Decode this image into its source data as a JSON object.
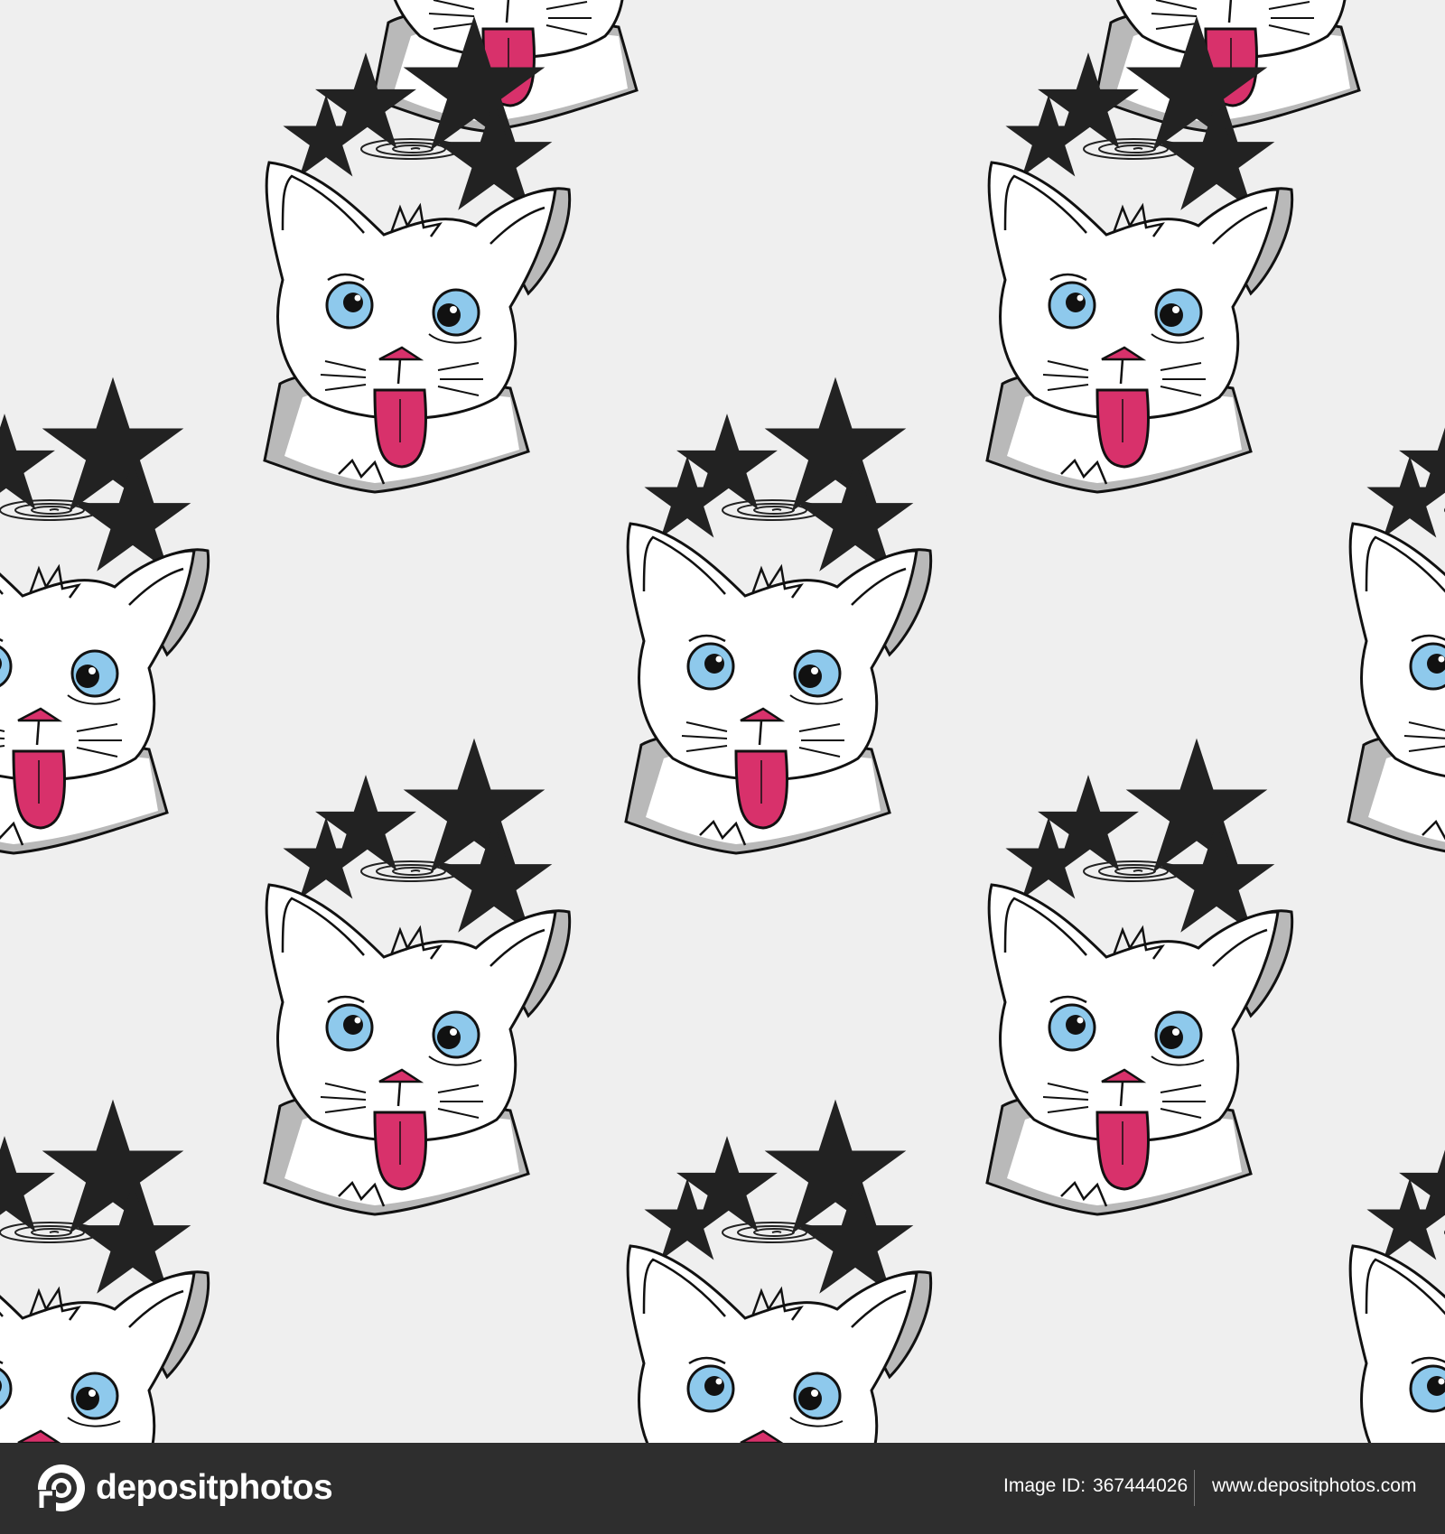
{
  "pattern": {
    "subject": "dizzy cat head with stars and spiral halo, tongue out",
    "colors": {
      "background": "#efefef",
      "fur": "#ffffff",
      "shadow": "#b9b9b9",
      "outline": "#111111",
      "eye": "#8ec9ec",
      "tongue": "#d8316b",
      "star": "#d8306a"
    }
  },
  "footer": {
    "brand": "depositphotos",
    "image_id_label": "Image ID:",
    "image_id": "367444026",
    "url": "www.depositphotos.com",
    "background": "#2e2e2e"
  }
}
